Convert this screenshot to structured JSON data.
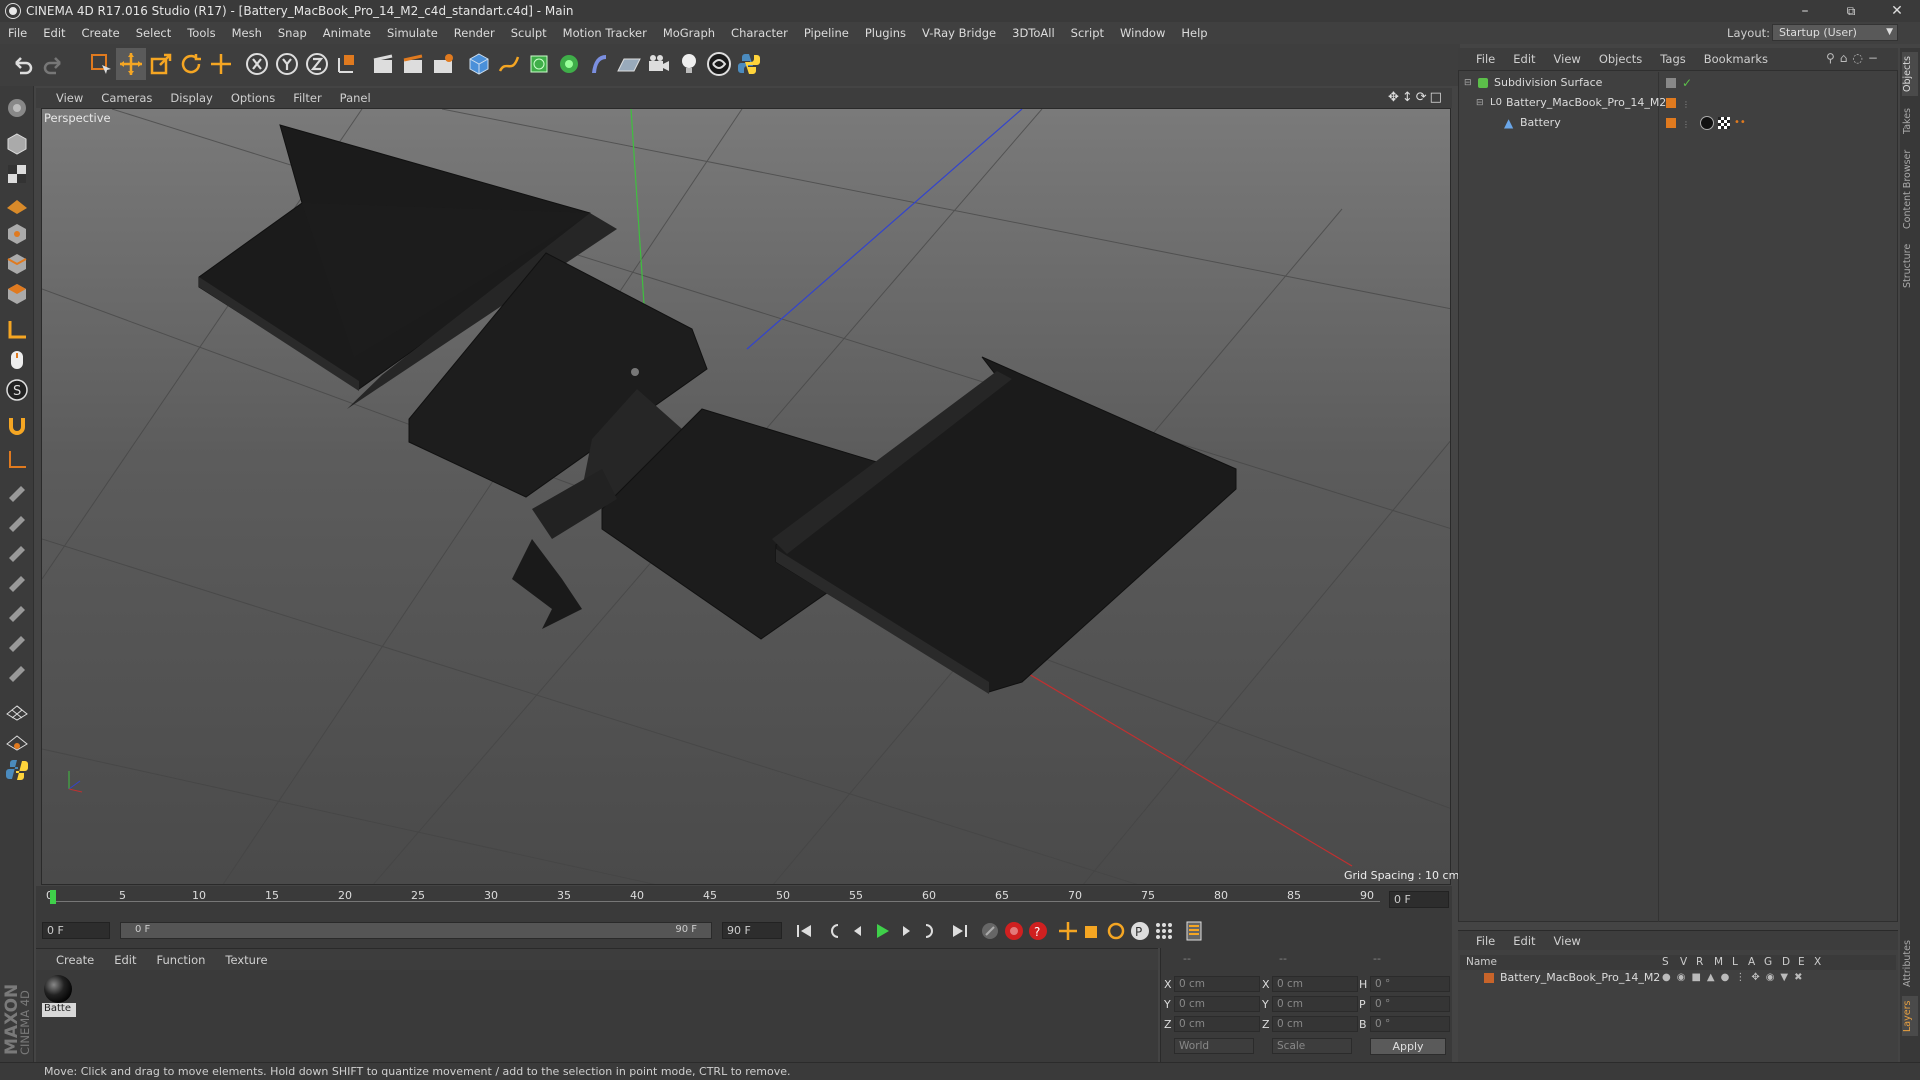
{
  "window": {
    "title": "CINEMA 4D R17.016 Studio (R17) - [Battery_MacBook_Pro_14_M2_c4d_standart.c4d] - Main",
    "minimize": "–",
    "restore": "⧉",
    "close": "✕"
  },
  "menu": [
    "File",
    "Edit",
    "Create",
    "Select",
    "Tools",
    "Mesh",
    "Snap",
    "Animate",
    "Simulate",
    "Render",
    "Sculpt",
    "Motion Tracker",
    "MoGraph",
    "Character",
    "Pipeline",
    "Plugins",
    "V-Ray Bridge",
    "3DToAll",
    "Script",
    "Window",
    "Help"
  ],
  "layout": {
    "label": "Layout:",
    "value": "Startup (User)"
  },
  "viewport": {
    "menu": [
      "View",
      "Cameras",
      "Display",
      "Options",
      "Filter",
      "Panel"
    ],
    "label": "Perspective",
    "grid_spacing": "Grid Spacing : 10 cm"
  },
  "timeline": {
    "ticks": [
      "0",
      "5",
      "10",
      "15",
      "20",
      "25",
      "30",
      "35",
      "40",
      "45",
      "50",
      "55",
      "60",
      "65",
      "70",
      "75",
      "80",
      "85",
      "90"
    ],
    "current_frame": "0 F",
    "start_field": "0 F",
    "range_start": "0 F",
    "range_end": "90 F",
    "end_field": "90 F"
  },
  "materials": {
    "menu": [
      "Create",
      "Edit",
      "Function",
      "Texture"
    ],
    "items": [
      {
        "name": "Batte"
      }
    ]
  },
  "coords": {
    "header": [
      "--",
      "--",
      "--"
    ],
    "rows": [
      {
        "axis": "X",
        "pos": "0 cm",
        "saxis": "X",
        "size": "0 cm",
        "raxis": "H",
        "rot": "0 °"
      },
      {
        "axis": "Y",
        "pos": "0 cm",
        "saxis": "Y",
        "size": "0 cm",
        "raxis": "P",
        "rot": "0 °"
      },
      {
        "axis": "Z",
        "pos": "0 cm",
        "saxis": "Z",
        "size": "0 cm",
        "raxis": "B",
        "rot": "0 °"
      }
    ],
    "world": "World",
    "scale": "Scale",
    "apply": "Apply"
  },
  "objects_panel": {
    "menu": [
      "File",
      "Edit",
      "View",
      "Objects",
      "Tags",
      "Bookmarks"
    ],
    "items": [
      {
        "name": "Subdivision Surface"
      },
      {
        "name": "Battery_MacBook_Pro_14_M2"
      },
      {
        "name": "Battery"
      }
    ]
  },
  "layers_panel": {
    "menu": [
      "File",
      "Edit",
      "View"
    ],
    "columns": [
      "Name",
      "S",
      "V",
      "R",
      "M",
      "L",
      "A",
      "G",
      "D",
      "E",
      "X"
    ],
    "items": [
      {
        "name": "Battery_MacBook_Pro_14_M2"
      }
    ]
  },
  "side_tabs": [
    "Objects",
    "Takes",
    "Content Browser",
    "Structure",
    "Attributes",
    "Layers"
  ],
  "branding": {
    "maxon": "MAXON",
    "cinema": "CINEMA 4D"
  },
  "status": "Move: Click and drag to move elements. Hold down SHIFT to quantize movement / add to the selection in point mode, CTRL to remove.",
  "colors": {
    "accent_orange": "#e07a1f",
    "object_green": "#5cbf4a",
    "layer_orange": "#c8642a"
  }
}
